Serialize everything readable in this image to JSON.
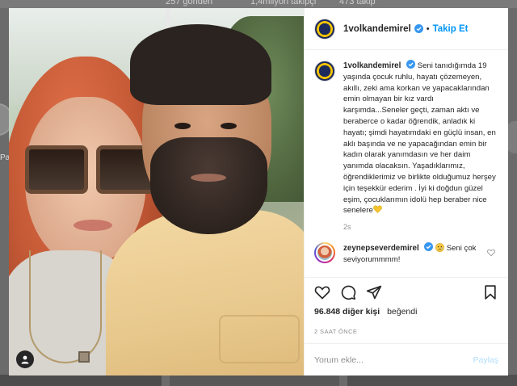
{
  "background": {
    "stats": [
      "257 gönderi",
      "1,4milyon takipçi",
      "473 takip"
    ],
    "left_label": "Pa"
  },
  "post": {
    "author": {
      "username": "1volkandemirel",
      "verified": true,
      "follow_label": "Takip Et",
      "separator": "•"
    },
    "caption": {
      "username": "1volkandemirel",
      "text": "Seni tanıdığımda 19 yaşında çocuk ruhlu, hayatı çözemeyen, akıllı, zeki ama korkan ve yapacaklarından emin olmayan bir kız vardı karşımda...Seneler geçti, zaman aktı ve beraberce o kadar öğrendik, anladık ki hayatı; şimdi hayatımdaki en güçlü insan, en aklı başında ve ne yapacağından emin bir kadın olarak yanımdasın ve her daim yanımda olacaksın. Yaşadıklarımız, öğrendiklerimiz ve birlikte olduğumuz herşey için teşekkür ederim . İyi ki doğdun güzel eşim, çocuklarımın idolü hep beraber nice senelere",
      "emoji": "yellow-heart",
      "age": "2s"
    },
    "comments": [
      {
        "username": "zeynepseverdemirel",
        "verified": true,
        "text": "Seni çok seviyorummmm!",
        "emoji": "crying-face"
      }
    ],
    "likes": {
      "count": "96.848",
      "suffix": "diğer kişi",
      "verb": "beğendi"
    },
    "date": "2 SAAT ÖNCE",
    "comment_input": {
      "placeholder": "Yorum ekle...",
      "post_label": "Paylaş"
    },
    "colors": {
      "accent": "#0095f6",
      "post_disabled": "#b2dffc",
      "muted": "#8e8e8e"
    }
  }
}
